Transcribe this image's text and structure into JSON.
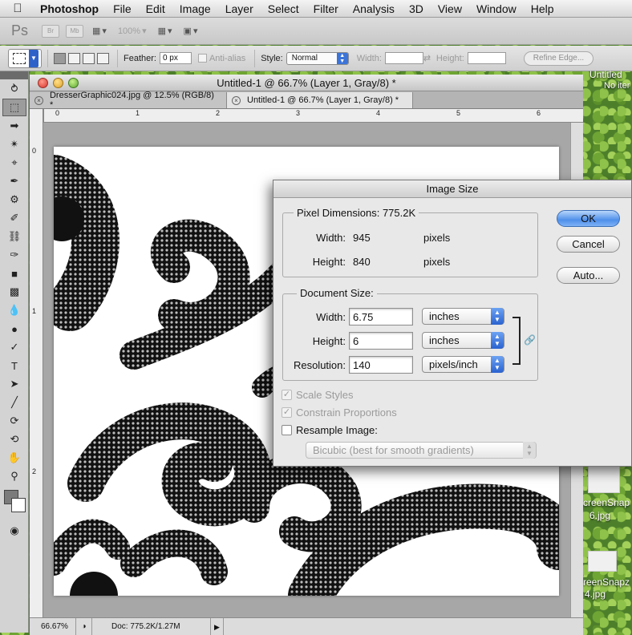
{
  "menubar": {
    "app": "Photoshop",
    "items": [
      "File",
      "Edit",
      "Image",
      "Layer",
      "Select",
      "Filter",
      "Analysis",
      "3D",
      "View",
      "Window",
      "Help"
    ]
  },
  "appbar": {
    "logo": "Ps",
    "chips": [
      "Br",
      "Mb"
    ],
    "zoom": "100%"
  },
  "options": {
    "feather_label": "Feather:",
    "feather_value": "0 px",
    "antialias_label": "Anti-alias",
    "style_label": "Style:",
    "style_value": "Normal",
    "width_label": "Width:",
    "height_label": "Height:",
    "refine_label": "Refine Edge..."
  },
  "document": {
    "window_title": "Untitled-1 @ 66.7% (Layer 1, Gray/8) *",
    "tabs": [
      {
        "label": "DresserGraphic024.jpg @ 12.5% (RGB/8) *"
      },
      {
        "label": "Untitled-1 @ 66.7% (Layer 1, Gray/8) *"
      }
    ],
    "ruler_h": [
      "0",
      "1",
      "2",
      "3",
      "4",
      "5",
      "6"
    ],
    "ruler_v": [
      "0",
      "1",
      "2"
    ],
    "status": {
      "zoom": "66.67%",
      "doc": "Doc: 775.2K/1.27M"
    }
  },
  "desktop": {
    "labels": [
      "Untitled",
      "No iter",
      "creenSnap",
      "6.jpg",
      "reenSnapz",
      "4.jpg"
    ]
  },
  "dialog": {
    "title": "Image Size",
    "pixel_dimensions": {
      "label": "Pixel Dimensions:",
      "size": "775.2K",
      "width_label": "Width:",
      "width_value": "945",
      "width_unit": "pixels",
      "height_label": "Height:",
      "height_value": "840",
      "height_unit": "pixels"
    },
    "document_size": {
      "label": "Document Size:",
      "width_label": "Width:",
      "width_value": "6.75",
      "width_unit": "inches",
      "height_label": "Height:",
      "height_value": "6",
      "height_unit": "inches",
      "resolution_label": "Resolution:",
      "resolution_value": "140",
      "resolution_unit": "pixels/inch"
    },
    "checkboxes": {
      "scale_styles": {
        "label": "Scale Styles",
        "checked": true,
        "enabled": false
      },
      "constrain": {
        "label": "Constrain Proportions",
        "checked": true,
        "enabled": false
      },
      "resample": {
        "label": "Resample Image:",
        "checked": false,
        "enabled": true
      }
    },
    "resample_method": "Bicubic (best for smooth gradients)",
    "buttons": {
      "ok": "OK",
      "cancel": "Cancel",
      "auto": "Auto..."
    }
  }
}
